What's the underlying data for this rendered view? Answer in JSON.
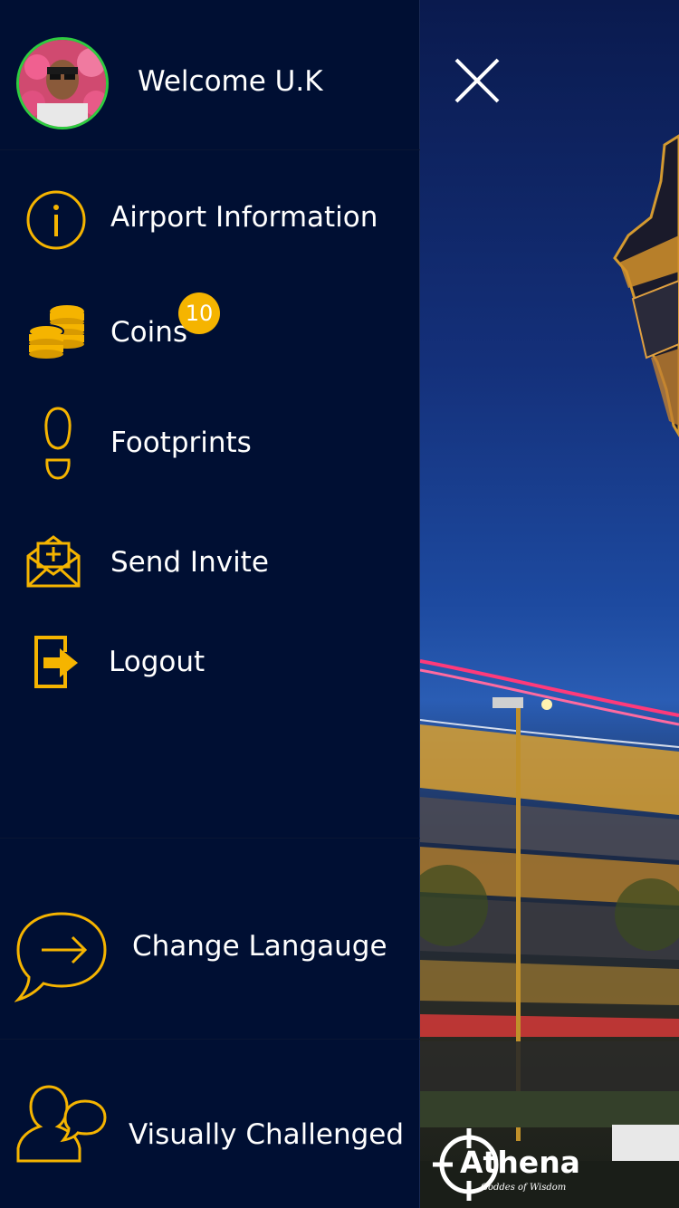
{
  "header": {
    "welcome_text": "Welcome U.K"
  },
  "menu": {
    "items": [
      {
        "label": "Airport Information",
        "icon": "info-icon"
      },
      {
        "label": "Coins",
        "icon": "coins-icon",
        "badge": "10"
      },
      {
        "label": "Footprints",
        "icon": "footprint-icon"
      },
      {
        "label": "Send Invite",
        "icon": "envelope-invite-icon"
      },
      {
        "label": "Logout",
        "icon": "logout-icon"
      }
    ]
  },
  "bottom": {
    "change_language": {
      "label": "Change Langauge",
      "icon": "speech-arrow-icon"
    },
    "visually_challenged": {
      "label": "Visually Challenged",
      "icon": "users-chat-icon"
    }
  },
  "brand": {
    "name": "Athena",
    "tagline": "Goddes of Wisdom"
  },
  "colors": {
    "drawer_bg": "#000f33",
    "accent": "#f5b400",
    "text": "#ffffff",
    "avatar_ring": "#2ecc40"
  }
}
